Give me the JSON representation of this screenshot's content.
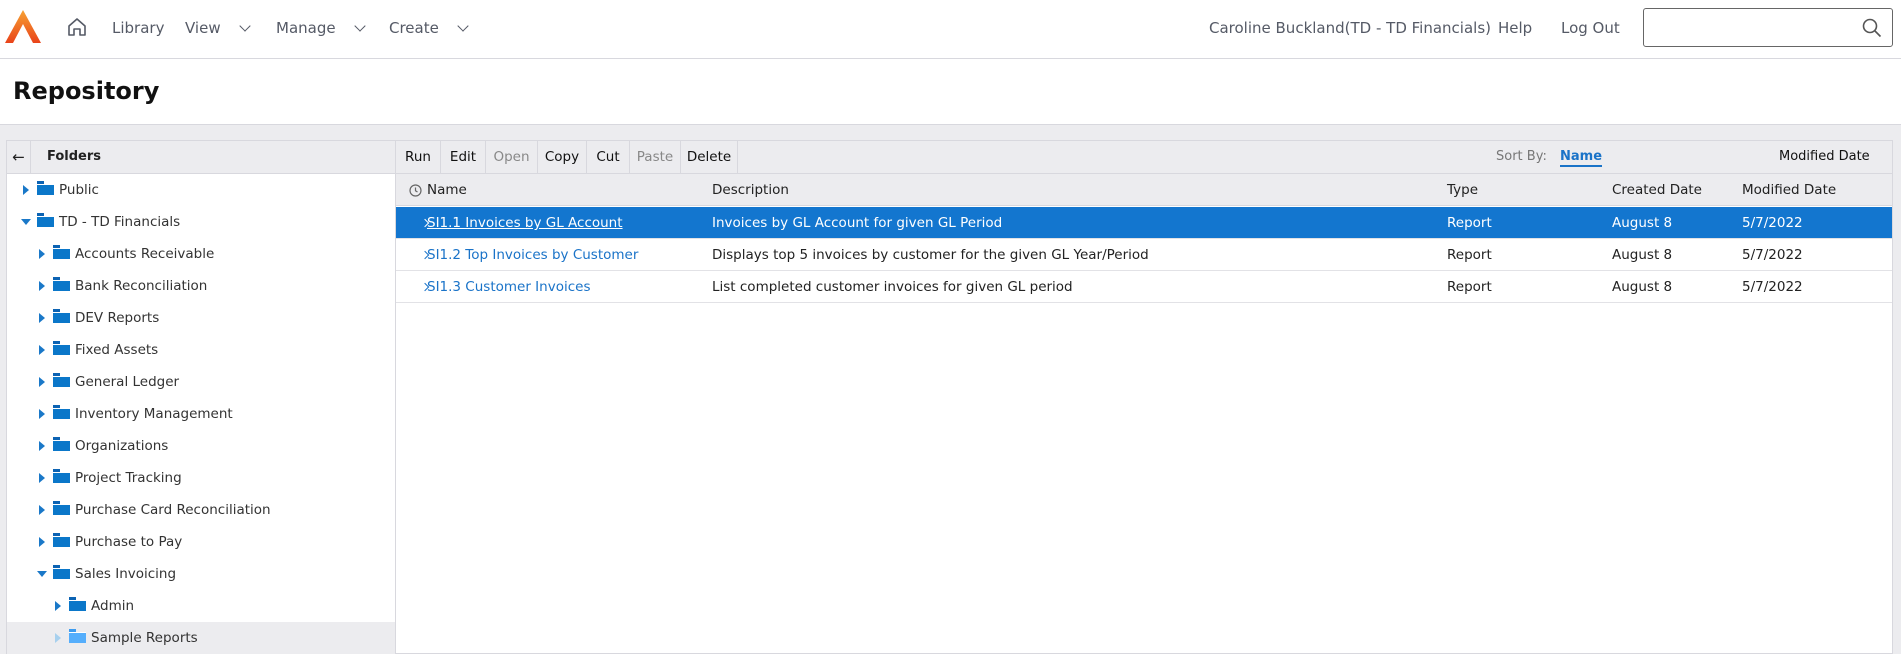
{
  "header": {
    "nav": [
      {
        "label": "Library",
        "dropdown": false
      },
      {
        "label": "View",
        "dropdown": true
      },
      {
        "label": "Manage",
        "dropdown": true
      },
      {
        "label": "Create",
        "dropdown": true
      }
    ],
    "user": "Caroline Buckland(TD - TD Financials)",
    "help": "Help",
    "logout": "Log Out",
    "search_value": ""
  },
  "page_title": "Repository",
  "folders": {
    "title": "Folders",
    "items": [
      {
        "label": "Public",
        "level": 0,
        "state": "collapsed"
      },
      {
        "label": "TD - TD Financials",
        "level": 0,
        "state": "expanded"
      },
      {
        "label": "Accounts Receivable",
        "level": 1,
        "state": "collapsed"
      },
      {
        "label": "Bank Reconciliation",
        "level": 1,
        "state": "collapsed"
      },
      {
        "label": "DEV Reports",
        "level": 1,
        "state": "collapsed"
      },
      {
        "label": "Fixed Assets",
        "level": 1,
        "state": "collapsed"
      },
      {
        "label": "General Ledger",
        "level": 1,
        "state": "collapsed"
      },
      {
        "label": "Inventory Management",
        "level": 1,
        "state": "collapsed"
      },
      {
        "label": "Organizations",
        "level": 1,
        "state": "collapsed"
      },
      {
        "label": "Project Tracking",
        "level": 1,
        "state": "collapsed"
      },
      {
        "label": "Purchase Card Reconciliation",
        "level": 1,
        "state": "collapsed"
      },
      {
        "label": "Purchase to Pay",
        "level": 1,
        "state": "collapsed"
      },
      {
        "label": "Sales Invoicing",
        "level": 1,
        "state": "expanded"
      },
      {
        "label": "Admin",
        "level": 2,
        "state": "collapsed"
      },
      {
        "label": "Sample Reports",
        "level": 2,
        "state": "selected"
      }
    ]
  },
  "toolbar": {
    "buttons": [
      {
        "label": "Run",
        "enabled": true
      },
      {
        "label": "Edit",
        "enabled": true
      },
      {
        "label": "Open",
        "enabled": false
      },
      {
        "label": "Copy",
        "enabled": true
      },
      {
        "label": "Cut",
        "enabled": true
      },
      {
        "label": "Paste",
        "enabled": false
      },
      {
        "label": "Delete",
        "enabled": true
      }
    ],
    "sort_by": "Sort By:",
    "sort_name": "Name",
    "sort_modified": "Modified Date"
  },
  "table": {
    "columns": [
      "Name",
      "Description",
      "Type",
      "Created Date",
      "Modified Date"
    ],
    "rows": [
      [
        "SI1.1 Invoices by GL Account",
        "Invoices by GL Account for given GL Period",
        "Report",
        "August 8",
        "5/7/2022"
      ],
      [
        "SI1.2 Top Invoices by Customer",
        "Displays top 5 invoices by customer for the given GL Year/Period",
        "Report",
        "August 8",
        "5/7/2022"
      ],
      [
        "SI1.3 Customer Invoices",
        "List completed customer invoices for given GL period",
        "Report",
        "August 8",
        "5/7/2022"
      ]
    ],
    "selected_row": 0
  },
  "colors": {
    "accent": "#1376cf",
    "logo": "#f0521d"
  }
}
